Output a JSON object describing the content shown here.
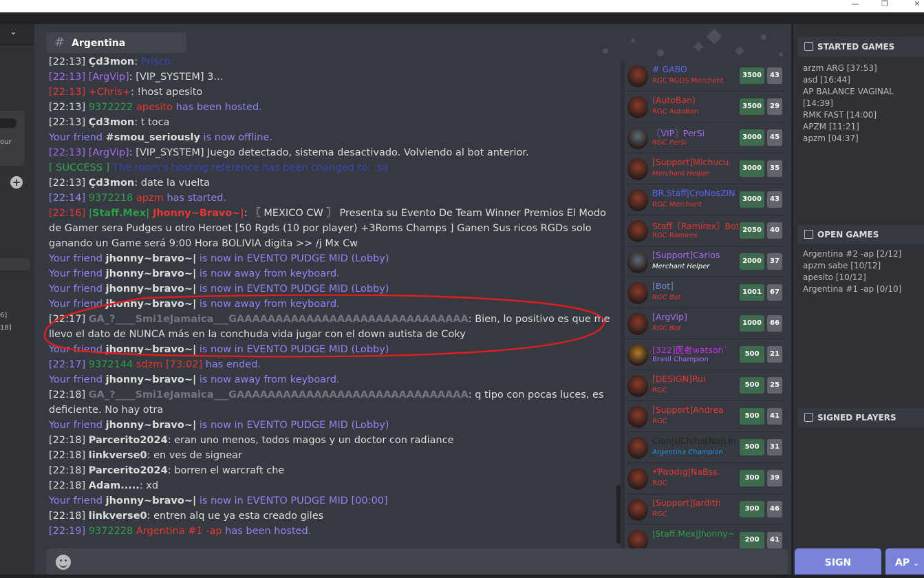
{
  "window": {
    "minimize": "—",
    "restore": "❐",
    "close": "✕"
  },
  "left": {
    "text1": "our",
    "num1": "6]",
    "num2": "18]"
  },
  "channel": {
    "name": "Argentina"
  },
  "chat": [
    {
      "time": "[22:13]",
      "user": "Çd3mon",
      "text": "Prisco."
    },
    {
      "time": "[22:13]",
      "user": "[ArgVip]",
      "text": "[VIP_SYSTEM] 3..."
    },
    {
      "time": "[22:13]",
      "user": "+Chris+",
      "text": "!host apesito"
    },
    {
      "time": "[22:13]",
      "id": "9372222",
      "game": "apesito",
      "text": "has been hosted."
    },
    {
      "time": "[22:13]",
      "user": "Çd3mon",
      "text": "t toca"
    },
    {
      "prefix": "Your friend",
      "user": "#smou_seriously",
      "text": "is now offline."
    },
    {
      "time": "[22:13]",
      "user": "[ArgVip]",
      "text": "[VIP_SYSTEM] Juego detectado, sistema desactivado. Volviendo al bot anterior."
    },
    {
      "tag": "[ SUCCESS ]",
      "text": "The room's hosting reference has been changed to:",
      "link": ".sa"
    },
    {
      "time": "[22:13]",
      "user": "Çd3mon",
      "text": "date la vuelta"
    },
    {
      "time": "[22:14]",
      "id": "9372218",
      "game": "apzm",
      "text": "has started."
    },
    {
      "time": "[22:16]",
      "user": "|Staff.Mex|",
      "user2": "Jhonny~Bravo~|",
      "text": "〖 MEXICO CW 〗 Presenta su Evento De Team Winner Premios El Modo de Gamer sera Pudges u otro Heroet [50 Rgds  (10 por player) +3Roms Champs ] Ganen Sus  ricos RGDs solo ganando un Game será 9:00 Hora BOLIVIA digita >> /j Mx Cw"
    },
    {
      "prefix": "Your friend",
      "user": "jhonny~bravo~|",
      "text": "is now in EVENTO PUDGE MID (Lobby)"
    },
    {
      "prefix": "Your friend",
      "user": "jhonny~bravo~|",
      "text": "is now away from keyboard."
    },
    {
      "prefix": "Your friend",
      "user": "jhonny~bravo~|",
      "text": "is now in EVENTO PUDGE MID (Lobby)"
    },
    {
      "prefix": "Your friend",
      "user": "jhonny~bravo~|",
      "text": "is now away from keyboard."
    },
    {
      "time": "[22:17]",
      "user": "GA_?____Smi1eJamaica___GAAAAAAAAAAAAAAAAAAAAAAAAAAAAAA",
      "text": "Bien, lo positivo es que me llevo el dato de NUNCA más en la conchuda vida jugar con el down autista de Coky"
    },
    {
      "prefix": "Your friend",
      "user": "jhonny~bravo~|",
      "text": "is now in EVENTO PUDGE MID (Lobby)"
    },
    {
      "time": "[22:17]",
      "id": "9372144",
      "game": "sdzm [73:02]",
      "text": "has ended."
    },
    {
      "prefix": "Your friend",
      "user": "jhonny~bravo~|",
      "text": "is now away from keyboard."
    },
    {
      "time": "[22:18]",
      "user": "GA_?____Smi1eJamaica___GAAAAAAAAAAAAAAAAAAAAAAAAAAAAAA",
      "text": "q tipo con pocas luces, es deficiente. No hay otra"
    },
    {
      "prefix": "Your friend",
      "user": "jhonny~bravo~|",
      "text": "is now in EVENTO PUDGE MID (Lobby)"
    },
    {
      "time": "[22:18]",
      "user": "Parcerito2024",
      "text": "eran uno menos, todos magos y un doctor con radiance"
    },
    {
      "time": "[22:18]",
      "user": "linkverse0",
      "text": "en ves de signear"
    },
    {
      "time": "[22:18]",
      "user": "Parcerito2024",
      "text": "borren el warcraft che"
    },
    {
      "time": "[22:18]",
      "user": "Adam.....",
      "text": "xd"
    },
    {
      "prefix": "Your friend",
      "user": "jhonny~bravo~|",
      "text": "is now in EVENTO PUDGE MID [00:00]"
    },
    {
      "time": "[22:18]",
      "user": "linkverse0",
      "text": "entren alq ue ya esta creado giles"
    },
    {
      "time": "[22:19]",
      "id": "9372228",
      "game": "Argentina #1 -ap",
      "text": "has been hosted."
    }
  ],
  "players": [
    {
      "name": "# GABO",
      "name_color": "#5865f2",
      "sub": "RGC RGDS Merchant",
      "sub_color": "#e53935",
      "italic": false,
      "pts": "3500",
      "lvl": "43"
    },
    {
      "name": "(AutoBan)",
      "name_color": "#e53935",
      "sub": "RGC AutoBan",
      "sub_color": "#e53935",
      "italic": false,
      "pts": "3500",
      "lvl": "29"
    },
    {
      "name": "〖VIP〗PerSi",
      "name_color": "#a46cf5",
      "sub": "RGC PerSi",
      "sub_color": "#e53935",
      "italic": true,
      "pts": "3000",
      "lvl": "45"
    },
    {
      "name": "[Support]Michucu.",
      "name_color": "#e53935",
      "prefix": "[Support]",
      "prefix_color": "#1e9be9",
      "sub": "Merchant Helper",
      "sub_color": "#e53935",
      "italic": true,
      "pts": "3000",
      "lvl": "35"
    },
    {
      "name": "BR.Staff|CroNosZIN",
      "name_color": "#5865f2",
      "sub": "RGC Merchant",
      "sub_color": "#e53935",
      "italic": false,
      "pts": "3000",
      "lvl": "43"
    },
    {
      "name": "Staff〔Ramirex〕Bot",
      "name_color": "#e53935",
      "sub": "RGC Ramirex",
      "sub_color": "#e53935",
      "italic": false,
      "pts": "2050",
      "lvl": "40"
    },
    {
      "name": "[Support]Carlos",
      "name_color": "#a46cf5",
      "prefix": "[Support]",
      "prefix_color": "#1e9be9",
      "sub": "Merchant Helper",
      "sub_color": "#ffffff",
      "italic": true,
      "pts": "2000",
      "lvl": "37"
    },
    {
      "name": "[Bot]",
      "name_color": "#7289da",
      "sub": "RGC Bot",
      "sub_color": "#e53935",
      "italic": true,
      "pts": "1001",
      "lvl": "67"
    },
    {
      "name": "[ArgVip]",
      "name_color": "#a46cf5",
      "sub": "RGC Bot",
      "sub_color": "#e53935",
      "italic": true,
      "pts": "1000",
      "lvl": "66"
    },
    {
      "name": "[322]医者watson`",
      "name_color": "#c233e6",
      "sub": "Brasil Champion",
      "sub_color": "#a46cf5",
      "italic": false,
      "pts": "500",
      "lvl": "21"
    },
    {
      "name": "[DESIGN]Rui",
      "name_color": "#e53935",
      "sub": "RGC",
      "sub_color": "#e53935",
      "italic": false,
      "pts": "500",
      "lvl": "25"
    },
    {
      "name": "[Support]Andrea",
      "name_color": "#e53935",
      "prefix": "[Support]",
      "prefix_color": "#1e9be9",
      "sub": "RGC",
      "sub_color": "#e53935",
      "italic": false,
      "pts": "500",
      "lvl": "41"
    },
    {
      "name": "Clan|UChiha[No|Lin",
      "name_color": "#222222",
      "sub": "Argentina Champion",
      "sub_color": "#1e9be9",
      "italic": true,
      "pts": "500",
      "lvl": "31"
    },
    {
      "name": "•Ƥασdιg|NaBss.",
      "name_color": "#e53935",
      "sub": "RGC",
      "sub_color": "#e53935",
      "italic": false,
      "pts": "300",
      "lvl": "39"
    },
    {
      "name": "[Support]Jardith",
      "name_color": "#e53935",
      "prefix": "[Support]",
      "prefix_color": "#1e9be9",
      "sub": "RGC",
      "sub_color": "#e53935",
      "italic": true,
      "pts": "300",
      "lvl": "46"
    },
    {
      "name": "|Staff.Mex|Jhonny~",
      "name_color": "#2e9e4d",
      "sub": "",
      "sub_color": "#e53935",
      "italic": false,
      "pts": "200",
      "lvl": "41"
    }
  ],
  "right": {
    "started_title": "STARTED GAMES",
    "started": [
      "arzm ARG [37:53]",
      "asd [16:44]",
      "AP BALANCE VAGINAL [14:39]",
      "RMK FAST [14:00]",
      "APZM [11:21]",
      "apzm [04:37]"
    ],
    "open_title": "OPEN GAMES",
    "open": [
      "Argentina #2 -ap [2/12]",
      "apzm sabe [10/12]",
      "apesito [10/12]",
      "Argentina #1 -ap [0/10]"
    ],
    "signed_title": "SIGNED PLAYERS"
  },
  "buttons": {
    "sign": "SIGN",
    "ap": "AP"
  },
  "colors": {
    "accent": "#7983d9",
    "chat_bg": "#36393f",
    "side_bg": "#2f3136"
  }
}
